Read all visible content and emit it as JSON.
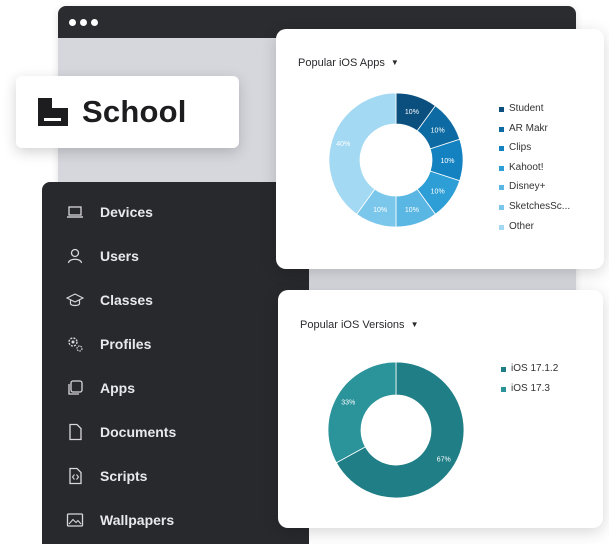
{
  "brand": {
    "name": "School"
  },
  "sidebar": {
    "items": [
      {
        "label": "Devices",
        "icon": "laptop-icon"
      },
      {
        "label": "Users",
        "icon": "user-icon"
      },
      {
        "label": "Classes",
        "icon": "graduation-cap-icon"
      },
      {
        "label": "Profiles",
        "icon": "settings-gears-icon"
      },
      {
        "label": "Apps",
        "icon": "apps-icon"
      },
      {
        "label": "Documents",
        "icon": "document-icon"
      },
      {
        "label": "Scripts",
        "icon": "script-icon"
      },
      {
        "label": "Wallpapers",
        "icon": "image-icon"
      }
    ]
  },
  "colors": {
    "sidebar_bg": "#28292d",
    "app_blues": [
      "#0b4f7e",
      "#0d6aa2",
      "#1482c0",
      "#2d9ed6",
      "#5ab6e3",
      "#7bc7eb",
      "#a3d9f2"
    ],
    "ios_teals": [
      "#1f7e86",
      "#2b939a"
    ]
  },
  "chart_data": [
    {
      "type": "pie",
      "title": "Popular iOS Apps",
      "categories": [
        "Student",
        "AR Makr",
        "Clips",
        "Kahoot!",
        "Disney+",
        "SketchesSc...",
        "Other"
      ],
      "values": [
        10,
        10,
        10,
        10,
        10,
        10,
        40
      ],
      "data_labels": [
        "10%",
        "10%",
        "10%",
        "10%",
        "10%",
        "10%",
        "40%"
      ],
      "legend": "right"
    },
    {
      "type": "pie",
      "title": "Popular iOS Versions",
      "categories": [
        "iOS 17.1.2",
        "iOS 17.3"
      ],
      "values": [
        67,
        33
      ],
      "data_labels": [
        "67%",
        "33%"
      ],
      "legend": "right"
    }
  ]
}
